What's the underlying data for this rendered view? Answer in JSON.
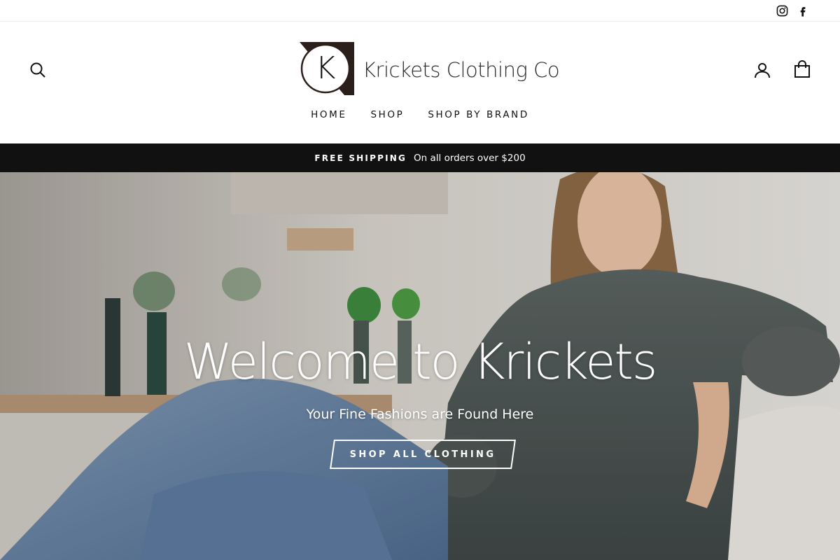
{
  "social": {
    "instagram_icon": "instagram-icon",
    "facebook_icon": "facebook-icon"
  },
  "header": {
    "logo_text": "Krickets Clothing Co",
    "logo_letter": "K",
    "search_icon": "search-icon",
    "account_icon": "user-icon",
    "cart_icon": "shopping-bag-icon",
    "nav": [
      {
        "label": "HOME"
      },
      {
        "label": "SHOP"
      },
      {
        "label": "SHOP BY BRAND"
      }
    ]
  },
  "announcement": {
    "strong": "FREE SHIPPING",
    "text": "On all orders over $200"
  },
  "hero": {
    "title": "Welcome to Krickets",
    "subtitle": "Your Fine Fashions are Found Here",
    "button_label": "SHOP ALL CLOTHING"
  },
  "colors": {
    "announcement_bg": "#111111",
    "text": "#111111",
    "hero_text": "#ffffff"
  }
}
